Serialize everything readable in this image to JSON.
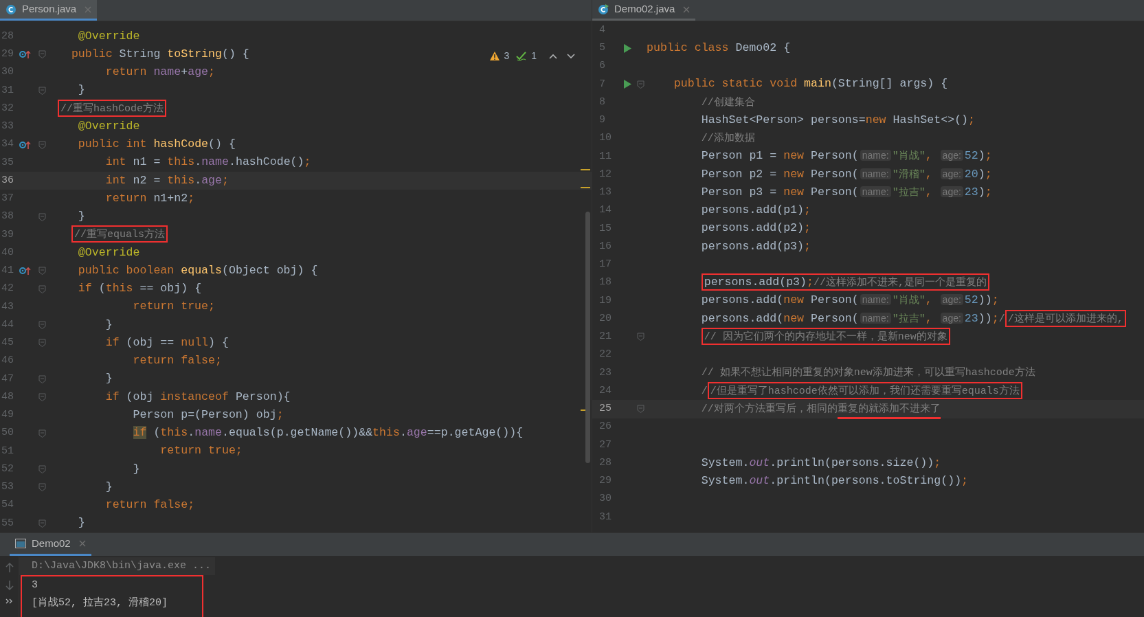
{
  "editors": [
    {
      "tab": {
        "title": "Person.java",
        "selected": true
      },
      "inspections": {
        "warnings": "3",
        "passed": "1"
      },
      "lines": [
        {
          "number": "28",
          "kind": "plain",
          "tokens": [
            {
              "kind": "annotation",
              "text": "    @Override"
            }
          ]
        },
        {
          "number": "29",
          "kind": "override",
          "fold": true,
          "tokens": [
            {
              "kind": "keyword",
              "text": "   public "
            },
            {
              "kind": "plain",
              "text": "String "
            },
            {
              "kind": "decl",
              "text": "toString"
            },
            {
              "kind": "plain",
              "text": "() {"
            }
          ]
        },
        {
          "number": "30",
          "kind": "plain",
          "tokens": [
            {
              "kind": "keyword",
              "text": "        return "
            },
            {
              "kind": "field",
              "text": "name"
            },
            {
              "kind": "plain",
              "text": "+"
            },
            {
              "kind": "field",
              "text": "age"
            },
            {
              "kind": "keyword",
              "text": ";"
            }
          ]
        },
        {
          "number": "31",
          "kind": "plain",
          "fold": true,
          "tokens": [
            {
              "kind": "plain",
              "text": "    }"
            }
          ]
        },
        {
          "number": "32",
          "kind": "plain",
          "tokens": [
            {
              "kind": "comment",
              "text": " //重写hashCode方法",
              "boxed": true
            }
          ]
        },
        {
          "number": "33",
          "kind": "plain",
          "tokens": [
            {
              "kind": "annotation",
              "text": "    @Override"
            }
          ]
        },
        {
          "number": "34",
          "kind": "override",
          "fold": true,
          "tokens": [
            {
              "kind": "keyword",
              "text": "    public int "
            },
            {
              "kind": "decl",
              "text": "hashCode"
            },
            {
              "kind": "plain",
              "text": "() {"
            }
          ]
        },
        {
          "number": "35",
          "kind": "plain",
          "tokens": [
            {
              "kind": "keyword",
              "text": "        int "
            },
            {
              "kind": "plain",
              "text": "n1 = "
            },
            {
              "kind": "keyword",
              "text": "this"
            },
            {
              "kind": "plain",
              "text": "."
            },
            {
              "kind": "field",
              "text": "name"
            },
            {
              "kind": "plain",
              "text": ".hashCode()"
            },
            {
              "kind": "keyword",
              "text": ";"
            }
          ]
        },
        {
          "number": "36",
          "kind": "plain",
          "current": true,
          "tokens": [
            {
              "kind": "keyword",
              "text": "        int "
            },
            {
              "kind": "plain",
              "text": "n2 = "
            },
            {
              "kind": "keyword",
              "text": "this"
            },
            {
              "kind": "plain",
              "text": "."
            },
            {
              "kind": "field",
              "text": "age"
            },
            {
              "kind": "keyword",
              "text": ";"
            }
          ]
        },
        {
          "number": "37",
          "kind": "plain",
          "tokens": [
            {
              "kind": "keyword",
              "text": "        return "
            },
            {
              "kind": "plain",
              "text": "n1+n2"
            },
            {
              "kind": "keyword",
              "text": ";"
            }
          ]
        },
        {
          "number": "38",
          "kind": "plain",
          "fold": true,
          "tokens": [
            {
              "kind": "plain",
              "text": "    }"
            }
          ]
        },
        {
          "number": "39",
          "kind": "plain",
          "tokens": [
            {
              "kind": "comment",
              "text": "   //重写equals方法",
              "boxed": true
            }
          ]
        },
        {
          "number": "40",
          "kind": "plain",
          "tokens": [
            {
              "kind": "annotation",
              "text": "    @Override"
            }
          ]
        },
        {
          "number": "41",
          "kind": "override",
          "fold": true,
          "tokens": [
            {
              "kind": "keyword",
              "text": "    public boolean "
            },
            {
              "kind": "decl",
              "text": "equals"
            },
            {
              "kind": "plain",
              "text": "(Object obj) {"
            }
          ]
        },
        {
          "number": "42",
          "kind": "plain",
          "fold": true,
          "tokens": [
            {
              "kind": "keyword",
              "text": "    if "
            },
            {
              "kind": "plain",
              "text": "("
            },
            {
              "kind": "keyword",
              "text": "this"
            },
            {
              "kind": "plain",
              "text": " == obj) {"
            }
          ]
        },
        {
          "number": "43",
          "kind": "plain",
          "tokens": [
            {
              "kind": "keyword",
              "text": "            return true;"
            }
          ]
        },
        {
          "number": "44",
          "kind": "plain",
          "fold": true,
          "tokens": [
            {
              "kind": "plain",
              "text": "        }"
            }
          ]
        },
        {
          "number": "45",
          "kind": "plain",
          "fold": true,
          "tokens": [
            {
              "kind": "keyword",
              "text": "        if "
            },
            {
              "kind": "plain",
              "text": "(obj == "
            },
            {
              "kind": "keyword",
              "text": "null"
            },
            {
              "kind": "plain",
              "text": ") {"
            }
          ]
        },
        {
          "number": "46",
          "kind": "plain",
          "tokens": [
            {
              "kind": "keyword",
              "text": "            return false;"
            }
          ]
        },
        {
          "number": "47",
          "kind": "plain",
          "fold": true,
          "tokens": [
            {
              "kind": "plain",
              "text": "        }"
            }
          ]
        },
        {
          "number": "48",
          "kind": "plain",
          "fold": true,
          "tokens": [
            {
              "kind": "keyword",
              "text": "        if "
            },
            {
              "kind": "plain",
              "text": "(obj "
            },
            {
              "kind": "keyword",
              "text": "instanceof "
            },
            {
              "kind": "plain",
              "text": "Person){"
            }
          ]
        },
        {
          "number": "49",
          "kind": "plain",
          "tokens": [
            {
              "kind": "plain",
              "text": "            Person p=(Person) obj"
            },
            {
              "kind": "keyword",
              "text": ";"
            }
          ]
        },
        {
          "number": "50",
          "kind": "plain",
          "fold": true,
          "tokens": [
            {
              "kind": "cursor",
              "text": "            if"
            },
            {
              "kind": "plain",
              "text": " ("
            },
            {
              "kind": "keyword",
              "text": "this"
            },
            {
              "kind": "plain",
              "text": "."
            },
            {
              "kind": "field",
              "text": "name"
            },
            {
              "kind": "plain",
              "text": ".equals(p.getName())&&"
            },
            {
              "kind": "keyword",
              "text": "this"
            },
            {
              "kind": "plain",
              "text": "."
            },
            {
              "kind": "field",
              "text": "age"
            },
            {
              "kind": "plain",
              "text": "==p.getAge()){"
            }
          ]
        },
        {
          "number": "51",
          "kind": "plain",
          "tokens": [
            {
              "kind": "keyword",
              "text": "                return true;"
            }
          ]
        },
        {
          "number": "52",
          "kind": "plain",
          "fold": true,
          "tokens": [
            {
              "kind": "plain",
              "text": "            }"
            }
          ]
        },
        {
          "number": "53",
          "kind": "plain",
          "fold": true,
          "tokens": [
            {
              "kind": "plain",
              "text": "        }"
            }
          ]
        },
        {
          "number": "54",
          "kind": "plain",
          "tokens": [
            {
              "kind": "keyword",
              "text": "        return false;"
            }
          ]
        },
        {
          "number": "55",
          "kind": "plain",
          "fold": true,
          "tokens": [
            {
              "kind": "plain",
              "text": "    }"
            }
          ]
        }
      ]
    },
    {
      "tab": {
        "title": "Demo02.java",
        "selected": false
      },
      "lines": [
        {
          "number": "4",
          "kind": "plain"
        },
        {
          "number": "5",
          "kind": "run",
          "tokens": [
            {
              "kind": "keyword",
              "text": "public class "
            },
            {
              "kind": "plain",
              "text": "Demo02 {"
            }
          ]
        },
        {
          "number": "6",
          "kind": "plain"
        },
        {
          "number": "7",
          "kind": "run",
          "fold": true,
          "tokens": [
            {
              "kind": "keyword",
              "text": "    public static void "
            },
            {
              "kind": "decl",
              "text": "main"
            },
            {
              "kind": "plain",
              "text": "(String[] args) {"
            }
          ]
        },
        {
          "number": "8",
          "kind": "plain",
          "tokens": [
            {
              "kind": "comment",
              "text": "        //创建集合"
            }
          ]
        },
        {
          "number": "9",
          "kind": "plain",
          "tokens": [
            {
              "kind": "plain",
              "text": "        HashSet<Person> persons="
            },
            {
              "kind": "keyword",
              "text": "new "
            },
            {
              "kind": "plain",
              "text": "HashSet<>()"
            },
            {
              "kind": "keyword",
              "text": ";"
            }
          ]
        },
        {
          "number": "10",
          "kind": "plain",
          "tokens": [
            {
              "kind": "comment",
              "text": "        //添加数据"
            }
          ]
        },
        {
          "number": "11",
          "kind": "plain",
          "tokens": [
            {
              "kind": "plain",
              "text": "        Person p1 = "
            },
            {
              "kind": "keyword",
              "text": "new "
            },
            {
              "kind": "plain",
              "text": "Person("
            },
            {
              "kind": "hint",
              "text": "name:"
            },
            {
              "kind": "string",
              "text": "\"肖战\""
            },
            {
              "kind": "keyword",
              "text": ", "
            },
            {
              "kind": "hint",
              "text": "age:"
            },
            {
              "kind": "number",
              "text": "52"
            },
            {
              "kind": "plain",
              "text": ")"
            },
            {
              "kind": "keyword",
              "text": ";"
            }
          ]
        },
        {
          "number": "12",
          "kind": "plain",
          "tokens": [
            {
              "kind": "plain",
              "text": "        Person p2 = "
            },
            {
              "kind": "keyword",
              "text": "new "
            },
            {
              "kind": "plain",
              "text": "Person("
            },
            {
              "kind": "hint",
              "text": "name:"
            },
            {
              "kind": "string",
              "text": "\"滑稽\""
            },
            {
              "kind": "keyword",
              "text": ", "
            },
            {
              "kind": "hint",
              "text": "age:"
            },
            {
              "kind": "number",
              "text": "20"
            },
            {
              "kind": "plain",
              "text": ")"
            },
            {
              "kind": "keyword",
              "text": ";"
            }
          ]
        },
        {
          "number": "13",
          "kind": "plain",
          "tokens": [
            {
              "kind": "plain",
              "text": "        Person p3 = "
            },
            {
              "kind": "keyword",
              "text": "new "
            },
            {
              "kind": "plain",
              "text": "Person("
            },
            {
              "kind": "hint",
              "text": "name:"
            },
            {
              "kind": "string",
              "text": "\"拉吉\""
            },
            {
              "kind": "keyword",
              "text": ", "
            },
            {
              "kind": "hint",
              "text": "age:"
            },
            {
              "kind": "number",
              "text": "23"
            },
            {
              "kind": "plain",
              "text": ")"
            },
            {
              "kind": "keyword",
              "text": ";"
            }
          ]
        },
        {
          "number": "14",
          "kind": "plain",
          "tokens": [
            {
              "kind": "plain",
              "text": "        persons.add(p1)"
            },
            {
              "kind": "keyword",
              "text": ";"
            }
          ]
        },
        {
          "number": "15",
          "kind": "plain",
          "tokens": [
            {
              "kind": "plain",
              "text": "        persons.add(p2)"
            },
            {
              "kind": "keyword",
              "text": ";"
            }
          ]
        },
        {
          "number": "16",
          "kind": "plain",
          "tokens": [
            {
              "kind": "plain",
              "text": "        persons.add(p3)"
            },
            {
              "kind": "keyword",
              "text": ";"
            }
          ]
        },
        {
          "number": "17",
          "kind": "plain"
        },
        {
          "number": "18",
          "kind": "plain",
          "tokens": [
            {
              "kind": "plain",
              "text": "        persons.add(p3)",
              "boxed": true
            },
            {
              "kind": "keyword",
              "text": ";",
              "boxed": true
            },
            {
              "kind": "comment",
              "text": "//这样添加不进来,是同一个是重复的",
              "boxed": true
            }
          ]
        },
        {
          "number": "19",
          "kind": "plain",
          "tokens": [
            {
              "kind": "plain",
              "text": "        persons.add("
            },
            {
              "kind": "keyword",
              "text": "new "
            },
            {
              "kind": "plain",
              "text": "Person("
            },
            {
              "kind": "hint",
              "text": "name:"
            },
            {
              "kind": "string",
              "text": "\"肖战\""
            },
            {
              "kind": "keyword",
              "text": ", "
            },
            {
              "kind": "hint",
              "text": "age:"
            },
            {
              "kind": "number",
              "text": "52"
            },
            {
              "kind": "plain",
              "text": "))"
            },
            {
              "kind": "keyword",
              "text": ";"
            }
          ]
        },
        {
          "number": "20",
          "kind": "plain",
          "tokens": [
            {
              "kind": "plain",
              "text": "        persons.add("
            },
            {
              "kind": "keyword",
              "text": "new "
            },
            {
              "kind": "plain",
              "text": "Person("
            },
            {
              "kind": "hint",
              "text": "name:"
            },
            {
              "kind": "string",
              "text": "\"拉吉\""
            },
            {
              "kind": "keyword",
              "text": ", "
            },
            {
              "kind": "hint",
              "text": "age:"
            },
            {
              "kind": "number",
              "text": "23"
            },
            {
              "kind": "plain",
              "text": "))"
            },
            {
              "kind": "keyword",
              "text": ";"
            },
            {
              "kind": "comment",
              "text": "/"
            },
            {
              "kind": "comment",
              "text": "/这样是可以添加进来的,",
              "boxed": true
            }
          ]
        },
        {
          "number": "21",
          "kind": "plain",
          "fold": true,
          "tokens": [
            {
              "kind": "comment",
              "text": "        // 因为它们两个的内存地址不一样，是新new的对象",
              "boxed": true
            }
          ]
        },
        {
          "number": "22",
          "kind": "plain"
        },
        {
          "number": "23",
          "kind": "plain",
          "tokens": [
            {
              "kind": "comment",
              "text": "        // 如果不想让相同的重复的对象new添加进来，可以重写hashcode方法"
            }
          ]
        },
        {
          "number": "24",
          "kind": "plain",
          "tokens": [
            {
              "kind": "comment",
              "text": "        /"
            },
            {
              "kind": "comment",
              "text": "/但是重写了hashcode依然可以添加，我们还需要重写equals方法",
              "boxed": true
            }
          ]
        },
        {
          "number": "25",
          "kind": "plain",
          "current": true,
          "fold": true,
          "tokens": [
            {
              "kind": "comment",
              "text": "        //对两个方法重写后，相同的"
            },
            {
              "kind": "comment",
              "text": "重复的就添加不进来了",
              "underlined": true
            }
          ]
        },
        {
          "number": "26",
          "kind": "plain"
        },
        {
          "number": "27",
          "kind": "plain"
        },
        {
          "number": "28",
          "kind": "plain",
          "tokens": [
            {
              "kind": "plain",
              "text": "        System."
            },
            {
              "kind": "static",
              "text": "out"
            },
            {
              "kind": "plain",
              "text": ".println(persons.size())"
            },
            {
              "kind": "keyword",
              "text": ";"
            }
          ]
        },
        {
          "number": "29",
          "kind": "plain",
          "tokens": [
            {
              "kind": "plain",
              "text": "        System."
            },
            {
              "kind": "static",
              "text": "out"
            },
            {
              "kind": "plain",
              "text": ".println(persons.toString())"
            },
            {
              "kind": "keyword",
              "text": ";"
            }
          ]
        },
        {
          "number": "30",
          "kind": "plain"
        },
        {
          "number": "31",
          "kind": "plain"
        }
      ]
    }
  ],
  "run_panel": {
    "tab": {
      "title": "Demo02",
      "selected": true
    },
    "output_boxed": true,
    "console": [
      {
        "kind": "command",
        "text": "D:\\Java\\JDK8\\bin\\java.exe ..."
      },
      {
        "kind": "output",
        "text": "3"
      },
      {
        "kind": "output",
        "text": "[肖战52, 拉吉23, 滑稽20]"
      }
    ]
  }
}
